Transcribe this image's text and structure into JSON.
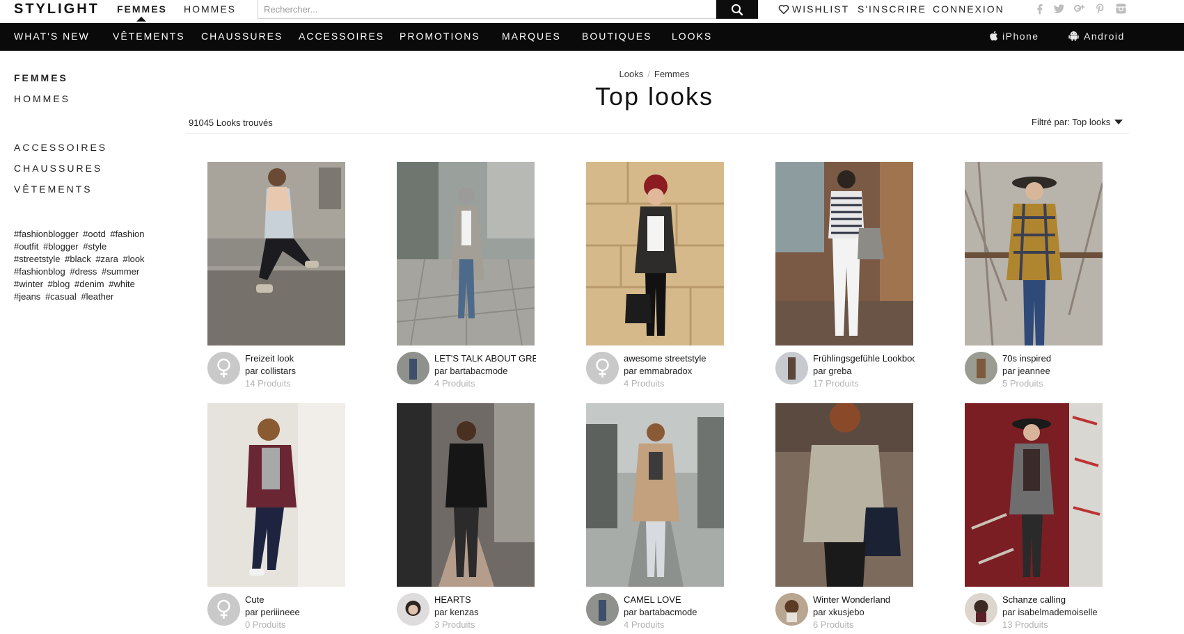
{
  "header": {
    "logo": "STYLIGHT",
    "gender_tabs": [
      "FEMMES",
      "HOMMES"
    ],
    "search_placeholder": "Rechercher...",
    "links": {
      "wishlist": "WISHLIST",
      "signup": "S'INSCRIRE",
      "login": "CONNEXION"
    },
    "social_icons": [
      "facebook-icon",
      "twitter-icon",
      "google-plus-icon",
      "pinterest-icon",
      "instagram-icon"
    ]
  },
  "nav": {
    "items": [
      "WHAT'S NEW",
      "VÊTEMENTS",
      "CHAUSSURES",
      "ACCESSOIRES",
      "PROMOTIONS",
      "MARQUES",
      "BOUTIQUES",
      "LOOKS"
    ],
    "apps": [
      "iPhone",
      "Android"
    ]
  },
  "sidebar": {
    "genders": [
      "FEMMES",
      "HOMMES"
    ],
    "categories": [
      "ACCESSOIRES",
      "CHAUSSURES",
      "VÊTEMENTS"
    ],
    "tags": [
      "#fashionblogger",
      "#ootd",
      "#fashion",
      "#outfit",
      "#blogger",
      "#style",
      "#streetstyle",
      "#black",
      "#zara",
      "#look",
      "#fashionblog",
      "#dress",
      "#summer",
      "#winter",
      "#blog",
      "#denim",
      "#white",
      "#jeans",
      "#casual",
      "#leather"
    ]
  },
  "main": {
    "breadcrumb": [
      "Looks",
      "Femmes"
    ],
    "title": "Top looks",
    "count": "91045 Looks trouvés",
    "filter": "Filtré par: Top looks"
  },
  "looks": [
    {
      "title": "Freizeit look",
      "author": "par collistars",
      "products": "14 Produits"
    },
    {
      "title": "LET'S TALK ABOUT GREY",
      "author": "par bartabacmode",
      "products": "4 Produits"
    },
    {
      "title": "awesome streetstyle",
      "author": "par emmabradox",
      "products": "4 Produits"
    },
    {
      "title": "Frühlingsgefühle Lookbook",
      "author": "par greba",
      "products": "17 Produits"
    },
    {
      "title": "70s inspired",
      "author": "par jeannee",
      "products": "5 Produits"
    },
    {
      "title": "Cute",
      "author": "par periiineee",
      "products": "0 Produits"
    },
    {
      "title": "HEARTS",
      "author": "par kenzas",
      "products": "3 Produits"
    },
    {
      "title": "CAMEL LOVE",
      "author": "par bartabacmode",
      "products": "4 Produits"
    },
    {
      "title": "Winter Wonderland",
      "author": "par xkusjebo",
      "products": "6 Produits"
    },
    {
      "title": "Schanze calling",
      "author": "par isabelmademoiselle",
      "products": "13 Produits"
    }
  ],
  "colors": {
    "nav_bg": "#0a0a0a",
    "accent": "#111111",
    "muted": "#b3b3b3"
  }
}
